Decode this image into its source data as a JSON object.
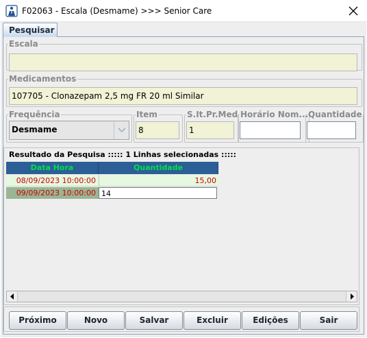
{
  "window": {
    "title": "F02063 - Escala (Desmame) >>> Senior Care"
  },
  "tabs": [
    {
      "label": "Pesquisar"
    }
  ],
  "escala": {
    "legend": "Escala",
    "value": ""
  },
  "medicamentos": {
    "legend": "Medicamentos",
    "value": "107705 - Clonazepam   2,5 mg  FR  20 ml   Similar"
  },
  "frequencia": {
    "legend": "Frequência",
    "value": "Desmame"
  },
  "item": {
    "legend": "Item",
    "value": "8"
  },
  "slt": {
    "legend": "S.It.Pr.Med",
    "value": "1"
  },
  "horario": {
    "legend": "Horário Nom...",
    "value": ""
  },
  "quantidade": {
    "legend": "Quantidade",
    "value": ""
  },
  "results": {
    "label": "Resultado da Pesquisa ::::: 1 Linhas selecionadas :::::",
    "columns": [
      "Data Hora",
      "Quantidade"
    ],
    "rows": [
      {
        "data_hora": "08/09/2023 10:00:00",
        "quantidade": "15,00"
      },
      {
        "data_hora": "09/09/2023 10:00:00",
        "quantidade": "14"
      }
    ]
  },
  "buttons": {
    "proximo": "Próximo",
    "novo": "Novo",
    "salvar": "Salvar",
    "excluir": "Excluir",
    "edicoes": "Edições",
    "sair": "Sair"
  },
  "colors": {
    "header_bg": "#2b5f95",
    "header_text": "#00e04c",
    "row_date_text": "#cc0000",
    "row_selected_bg": "#e6f8e0",
    "field_bg": "#f1f2d6"
  },
  "icons": {
    "app": "app-icon",
    "close": "close-icon",
    "combo_arrow": "chevron-down-icon",
    "scroll_left": "arrow-left-icon",
    "scroll_right": "arrow-right-icon"
  }
}
